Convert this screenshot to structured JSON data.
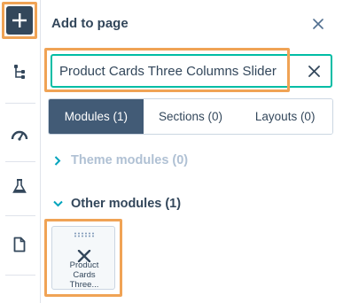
{
  "rail": {
    "items": [
      {
        "name": "add-icon",
        "active": true
      },
      {
        "name": "tree-icon"
      },
      {
        "name": "gauge-icon"
      },
      {
        "name": "flask-icon"
      },
      {
        "name": "document-icon"
      }
    ],
    "accent": "#33475b"
  },
  "panel": {
    "title": "Add to page",
    "close_icon": "close-icon"
  },
  "search": {
    "value": "Product Cards Three Columns Slider",
    "placeholder": "",
    "clear_icon": "close-icon"
  },
  "tabs": [
    {
      "label": "Modules (1)",
      "active": true
    },
    {
      "label": "Sections (0)",
      "active": false
    },
    {
      "label": "Layouts (0)",
      "active": false
    }
  ],
  "sections": {
    "theme": {
      "label": "Theme modules (0)",
      "expanded": false
    },
    "other": {
      "label": "Other modules (1)",
      "expanded": true
    }
  },
  "module_card": {
    "label_lines": [
      "Product",
      "Cards",
      "Three..."
    ],
    "icon": "tools-icon"
  },
  "colors": {
    "highlight": "#f0a355",
    "focus": "#00bda5",
    "active_tab": "#425b76",
    "text": "#33475b",
    "muted": "#b0c1d4"
  }
}
